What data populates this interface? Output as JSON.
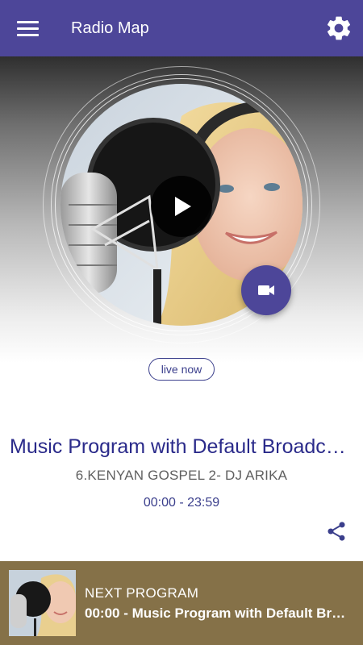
{
  "app_bar": {
    "title": "Radio Map",
    "menu_icon": "hamburger-menu-icon",
    "settings_icon": "gear-icon"
  },
  "player": {
    "play_icon": "play-icon",
    "video_icon": "video-camera-icon",
    "live_badge": "live now"
  },
  "program": {
    "title": "Music Program with Default Broadc…",
    "subtitle": "6.KENYAN GOSPEL 2- DJ ARIKA",
    "time": "00:00 - 23:59",
    "share_icon": "share-icon"
  },
  "next_program": {
    "label": "NEXT PROGRAM",
    "title": "00:00 - Music Program with Default Br…"
  },
  "colors": {
    "app_bar": "#4d4699",
    "accent": "#3b3f8c",
    "title_text": "#2a2a8a",
    "bottom_bar": "#857148"
  }
}
